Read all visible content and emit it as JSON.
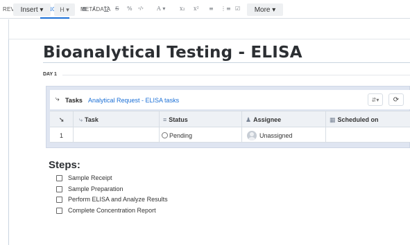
{
  "tabs": [
    {
      "label": "REVIEW",
      "active": false
    },
    {
      "label": "NOTES",
      "active": true
    },
    {
      "label": "METADATA",
      "active": false
    }
  ],
  "toolbar": {
    "insert_label": "Insert ▾",
    "heading_label": "H ▾",
    "bold": "B",
    "italic": "I",
    "underline": "U",
    "strikethrough": "S",
    "link": "%",
    "code": "‹/›",
    "font_color": "A ▾",
    "subscript": "x₂",
    "superscript": "x²",
    "bullet_list": "≡",
    "numbered_list": "⋮≡",
    "checklist": "☑",
    "more_label": "More ▾"
  },
  "document": {
    "title": "Bioanalytical Testing - ELISA",
    "section_label": "DAY 1"
  },
  "tasks_block": {
    "label": "Tasks",
    "link": "Analytical Request - ELISA tasks",
    "icon": "task-link-icon",
    "columns": [
      "Task",
      "Status",
      "Assignee",
      "Scheduled on"
    ],
    "rows": [
      {
        "index": "1",
        "task": "",
        "status": "Pending",
        "assignee": "Unassigned",
        "scheduled_on": ""
      }
    ]
  },
  "steps": {
    "heading": "Steps:",
    "items": [
      {
        "label": "Sample Receipt",
        "checked": false
      },
      {
        "label": "Sample Preparation",
        "checked": false
      },
      {
        "label": "Perform ELISA and Analyze Results",
        "checked": false
      },
      {
        "label": "Complete Concentration Report",
        "checked": false
      }
    ]
  },
  "colors": {
    "accent": "#1a6fd6",
    "tasks_block_bg": "#dfe5f1",
    "table_header_bg": "#eef1f5"
  }
}
